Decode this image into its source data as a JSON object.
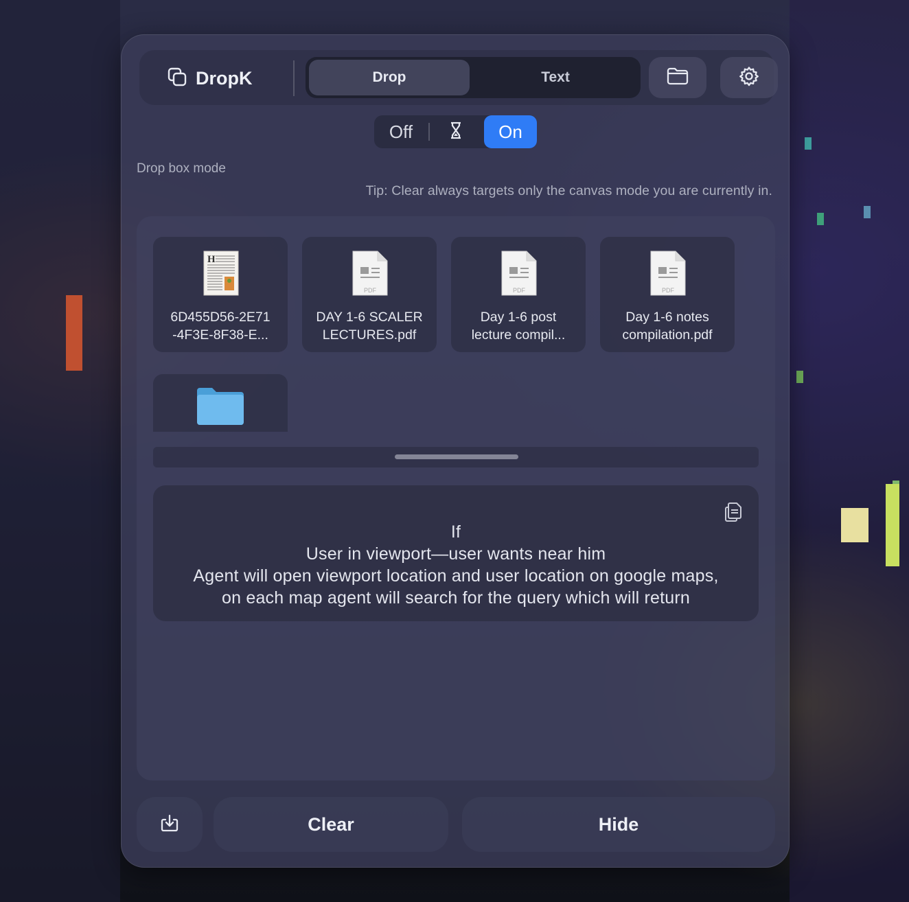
{
  "app": {
    "name": "DropK",
    "logo_icon": "duplicate-squares-icon"
  },
  "tabs": [
    {
      "label": "Drop",
      "active": true
    },
    {
      "label": "Text",
      "active": false
    }
  ],
  "header_buttons": {
    "folder_icon": "folder-icon",
    "settings_icon": "gear-icon"
  },
  "toggle": {
    "off_label": "Off",
    "timer_icon": "hourglass-icon",
    "on_label": "On",
    "selected": "On",
    "accent": "#2f7cf6"
  },
  "mode_label": "Drop box mode",
  "tip": "Tip: Clear always targets only the canvas mode you are currently in.",
  "files": [
    {
      "line1": "6D455D56-2E71",
      "line2": "-4F3E-8F38-E...",
      "icon": "document-thumbnail-icon"
    },
    {
      "line1": "DAY 1-6 SCALER",
      "line2": "LECTURES.pdf",
      "icon": "pdf-file-icon",
      "badge": "PDF"
    },
    {
      "line1": "Day 1-6 post",
      "line2": "lecture compil...",
      "icon": "pdf-file-icon",
      "badge": "PDF"
    },
    {
      "line1": "Day 1-6 notes",
      "line2": "compilation.pdf",
      "icon": "pdf-file-icon",
      "badge": "PDF"
    }
  ],
  "folder_item": {
    "icon": "folder-icon"
  },
  "text_card": {
    "lines": [
      "If",
      "User in viewport—user wants near him",
      "Agent will open viewport location and user location on google maps,",
      "on each map agent will search for the query which will return"
    ],
    "copy_icon": "copy-icon"
  },
  "footer": {
    "save_icon": "download-tray-icon",
    "clear_label": "Clear",
    "hide_label": "Hide"
  }
}
